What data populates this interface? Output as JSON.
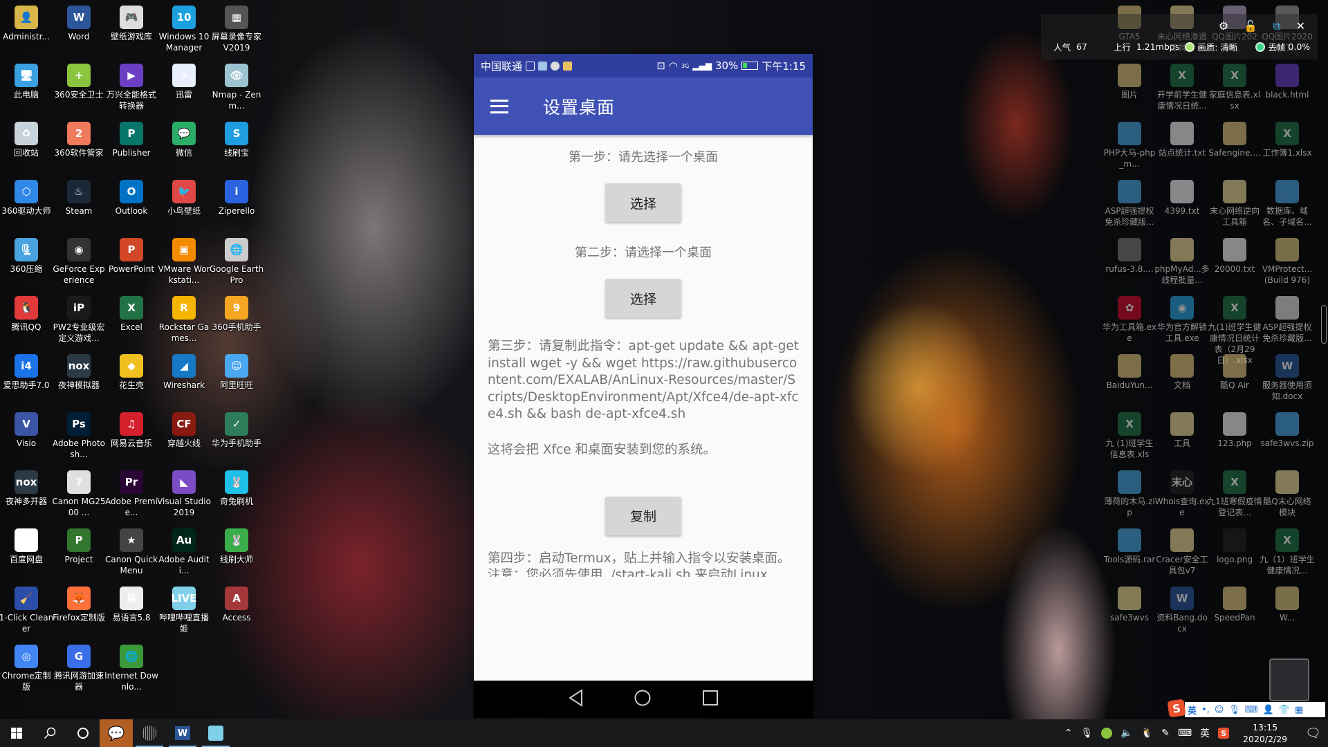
{
  "desktop_left": [
    {
      "label": "Administr...",
      "icon": "user-folder-icon",
      "color": "#d9b44a",
      "glyph": "👤"
    },
    {
      "label": "Word",
      "icon": "word-icon",
      "color": "#2b579a",
      "glyph": "W"
    },
    {
      "label": "壁纸游戏库",
      "icon": "gamepad-icon",
      "color": "#dddddd",
      "glyph": "🎮"
    },
    {
      "label": "Windows 10 Manager",
      "icon": "windows10-manager-icon",
      "color": "#1ba1e2",
      "glyph": "10"
    },
    {
      "label": "屏幕录像专家 V2019",
      "icon": "screen-recorder-icon",
      "color": "#555555",
      "glyph": "▦"
    },
    {
      "label": "此电脑",
      "icon": "computer-icon",
      "color": "#3aa0e0",
      "glyph": "🖥"
    },
    {
      "label": "360安全卫士",
      "icon": "360-safe-icon",
      "color": "#8bc53f",
      "glyph": "+"
    },
    {
      "label": "万兴全能格式转换器",
      "icon": "video-converter-icon",
      "color": "#6a3fc4",
      "glyph": "▶"
    },
    {
      "label": "迅雷",
      "icon": "thunder-icon",
      "color": "#e8eefc",
      "glyph": "✈"
    },
    {
      "label": "Nmap - Zenm...",
      "icon": "nmap-eye-icon",
      "color": "#9cc3d0",
      "glyph": "👁"
    },
    {
      "label": "回收站",
      "icon": "recycle-bin-icon",
      "color": "#c8d2da",
      "glyph": "♻"
    },
    {
      "label": "360软件管家",
      "icon": "360-software-manager-icon",
      "color": "#f07a5c",
      "glyph": "2"
    },
    {
      "label": "Publisher",
      "icon": "publisher-icon",
      "color": "#077568",
      "glyph": "P"
    },
    {
      "label": "微信",
      "icon": "wechat-icon",
      "color": "#2aae67",
      "glyph": "💬"
    },
    {
      "label": "线刷宝",
      "icon": "xianshuabao-icon",
      "color": "#1e9de0",
      "glyph": "S"
    },
    {
      "label": "360驱动大师",
      "icon": "360-driver-icon",
      "color": "#2f88e8",
      "glyph": "⬡"
    },
    {
      "label": "Steam",
      "icon": "steam-icon",
      "color": "#1b2838",
      "glyph": "♨"
    },
    {
      "label": "Outlook",
      "icon": "outlook-icon",
      "color": "#0072c6",
      "glyph": "O"
    },
    {
      "label": "小鸟壁纸",
      "icon": "bird-wallpaper-icon",
      "color": "#e04848",
      "glyph": "🐦"
    },
    {
      "label": "Ziperello",
      "icon": "ziperello-icon",
      "color": "#2a62e0",
      "glyph": "i"
    },
    {
      "label": "360压缩",
      "icon": "360-zip-icon",
      "color": "#4aa3df",
      "glyph": "🗜"
    },
    {
      "label": "GeForce Experience",
      "icon": "geforce-icon",
      "color": "#333333",
      "glyph": "◉"
    },
    {
      "label": "PowerPoint",
      "icon": "powerpoint-icon",
      "color": "#d24726",
      "glyph": "P"
    },
    {
      "label": "VMware Workstati...",
      "icon": "vmware-icon",
      "color": "#f38b00",
      "glyph": "▣"
    },
    {
      "label": "Google Earth Pro",
      "icon": "google-earth-icon",
      "color": "#cccccc",
      "glyph": "🌐"
    },
    {
      "label": "腾讯QQ",
      "icon": "qq-icon",
      "color": "#e23a3a",
      "glyph": "🐧"
    },
    {
      "label": "PW2专业级宏定义游戏...",
      "icon": "pw2-icon",
      "color": "#1a1a1a",
      "glyph": "iP"
    },
    {
      "label": "Excel",
      "icon": "excel-icon",
      "color": "#217346",
      "glyph": "X"
    },
    {
      "label": "Rockstar Games...",
      "icon": "rockstar-icon",
      "color": "#f4b400",
      "glyph": "R"
    },
    {
      "label": "360手机助手",
      "icon": "360-phone-assistant-icon",
      "color": "#f5a623",
      "glyph": "9"
    },
    {
      "label": "爱思助手7.0",
      "icon": "i4-icon",
      "color": "#1a73e8",
      "glyph": "i4"
    },
    {
      "label": "夜神模拟器",
      "icon": "nox-icon",
      "color": "#2b3a44",
      "glyph": "nox"
    },
    {
      "label": "花生壳",
      "icon": "peanut-shell-icon",
      "color": "#f0c020",
      "glyph": "◆"
    },
    {
      "label": "Wireshark",
      "icon": "wireshark-icon",
      "color": "#1679c5",
      "glyph": "◢"
    },
    {
      "label": "阿里旺旺",
      "icon": "aliwangwang-icon",
      "color": "#4aa8f0",
      "glyph": "☺"
    },
    {
      "label": "Visio",
      "icon": "visio-icon",
      "color": "#3955a3",
      "glyph": "V"
    },
    {
      "label": "Adobe Photosh...",
      "icon": "photoshop-icon",
      "color": "#001e36",
      "glyph": "Ps"
    },
    {
      "label": "网易云音乐",
      "icon": "netease-music-icon",
      "color": "#d4202a",
      "glyph": "♫"
    },
    {
      "label": "穿越火线",
      "icon": "crossfire-icon",
      "color": "#8a1a10",
      "glyph": "CF"
    },
    {
      "label": "华为手机助手",
      "icon": "huawei-hisuite-icon",
      "color": "#2e7d5a",
      "glyph": "✓"
    },
    {
      "label": "夜神多开器",
      "icon": "nox-multi-icon",
      "color": "#2b3a44",
      "glyph": "nox"
    },
    {
      "label": "Canon MG2500 ...",
      "icon": "canon-printer-icon",
      "color": "#e0e0e0",
      "glyph": "?"
    },
    {
      "label": "Adobe Premie...",
      "icon": "premiere-icon",
      "color": "#2a0634",
      "glyph": "Pr"
    },
    {
      "label": "Visual Studio 2019",
      "icon": "visual-studio-icon",
      "color": "#7b4cc4",
      "glyph": "◣"
    },
    {
      "label": "奇兔刷机",
      "icon": "qitu-icon",
      "color": "#1ec0e8",
      "glyph": "🐰"
    },
    {
      "label": "百度网盘",
      "icon": "baidu-netdisk-icon",
      "color": "#ffffff",
      "glyph": "☁"
    },
    {
      "label": "Project",
      "icon": "project-icon",
      "color": "#31752f",
      "glyph": "P"
    },
    {
      "label": "Canon Quick Menu",
      "icon": "canon-quick-menu-icon",
      "color": "#444444",
      "glyph": "★"
    },
    {
      "label": "Adobe Auditi...",
      "icon": "audition-icon",
      "color": "#00261c",
      "glyph": "Au"
    },
    {
      "label": "线刷大师",
      "icon": "xianshua-master-icon",
      "color": "#3aae4a",
      "glyph": "🐰"
    },
    {
      "label": "1-Click Cleaner",
      "icon": "broom-icon",
      "color": "#2b4fa8",
      "glyph": "🧹"
    },
    {
      "label": "Firefox定制版",
      "icon": "firefox-icon",
      "color": "#ff7139",
      "glyph": "🦊"
    },
    {
      "label": "易语言5.8",
      "icon": "eyuyan-icon",
      "color": "#eeeeee",
      "glyph": "易"
    },
    {
      "label": "哔哩哔哩直播姬",
      "icon": "bilibili-live-icon",
      "color": "#7fd0e8",
      "glyph": "LIVE"
    },
    {
      "label": "Access",
      "icon": "access-icon",
      "color": "#a4373a",
      "glyph": "A"
    },
    {
      "label": "Chrome定制版",
      "icon": "chrome-icon",
      "color": "#4285f4",
      "glyph": "◎"
    },
    {
      "label": "腾讯网游加速器",
      "icon": "tencent-accelerator-icon",
      "color": "#3a6ee8",
      "glyph": "G"
    },
    {
      "label": "Internet Downlo...",
      "icon": "idm-icon",
      "color": "#3a9a3a",
      "glyph": "🌐"
    }
  ],
  "desktop_right": [
    {
      "label": "GTA5",
      "icon": "folder-icon",
      "color": "#d9c27a",
      "glyph": ""
    },
    {
      "label": "末心网络渗透工具箱",
      "icon": "folder-icon",
      "color": "#e8d694",
      "glyph": ""
    },
    {
      "label": "QQ图片2020...",
      "icon": "image-file-icon",
      "color": "#b9a8c8",
      "glyph": ""
    },
    {
      "label": "QQ图片2020011...",
      "icon": "image-file-icon",
      "color": "#9a9a9a",
      "glyph": ""
    },
    {
      "label": "图片",
      "icon": "folder-icon",
      "color": "#d9c27a",
      "glyph": ""
    },
    {
      "label": "开学前学生健康情况日统...",
      "icon": "excel-file-icon",
      "color": "#217346",
      "glyph": "X"
    },
    {
      "label": "家庭信息表.xlsx",
      "icon": "excel-file-icon",
      "color": "#217346",
      "glyph": "X"
    },
    {
      "label": "black.html",
      "icon": "firefox-html-icon",
      "color": "#6a3fc4",
      "glyph": ""
    },
    {
      "label": "PHP大马-php_m...",
      "icon": "zip-file-icon",
      "color": "#4aa3df",
      "glyph": ""
    },
    {
      "label": "站点统计.txt",
      "icon": "text-file-icon",
      "color": "#eeeeee",
      "glyph": ""
    },
    {
      "label": "Safengine....",
      "icon": "folder-icon",
      "color": "#d9c27a",
      "glyph": ""
    },
    {
      "label": "工作簿1.xlsx",
      "icon": "excel-file-icon",
      "color": "#217346",
      "glyph": "X"
    },
    {
      "label": "ASP超强提权免杀珍藏版...",
      "icon": "zip-file-icon",
      "color": "#4aa3df",
      "glyph": ""
    },
    {
      "label": "4399.txt",
      "icon": "text-file-icon",
      "color": "#eeeeee",
      "glyph": ""
    },
    {
      "label": "末心网络逆向工具箱",
      "icon": "folder-icon",
      "color": "#e8d694",
      "glyph": ""
    },
    {
      "label": "数据库、域名、子域名...",
      "icon": "zip-file-icon",
      "color": "#4aa3df",
      "glyph": ""
    },
    {
      "label": "rufus-3.8....",
      "icon": "usb-icon",
      "color": "#777777",
      "glyph": ""
    },
    {
      "label": "phpMyAd...多线程批量...",
      "icon": "folder-icon",
      "color": "#e8d694",
      "glyph": ""
    },
    {
      "label": "20000.txt",
      "icon": "text-file-icon",
      "color": "#eeeeee",
      "glyph": ""
    },
    {
      "label": "VMProtect... (Build 976)",
      "icon": "folder-icon",
      "color": "#d9c27a",
      "glyph": ""
    },
    {
      "label": "华为工具箱.exe",
      "icon": "huawei-icon",
      "color": "#cf0a2c",
      "glyph": "✿"
    },
    {
      "label": "华为官方解锁工具.exe",
      "icon": "unlock-tool-icon",
      "color": "#2aa0e0",
      "glyph": "◉"
    },
    {
      "label": "九(1)班学生健康情况日统计表（2月29日）.xlsx",
      "icon": "excel-file-icon",
      "color": "#217346",
      "glyph": "X"
    },
    {
      "label": "ASP超强提权免杀珍藏版...",
      "icon": "blank-file-icon",
      "color": "#dddddd",
      "glyph": ""
    },
    {
      "label": "BaiduYun...",
      "icon": "folder-icon",
      "color": "#d9c27a",
      "glyph": ""
    },
    {
      "label": "文档",
      "icon": "folder-icon",
      "color": "#d9c27a",
      "glyph": ""
    },
    {
      "label": "酷Q Air",
      "icon": "folder-icon",
      "color": "#d9c27a",
      "glyph": ""
    },
    {
      "label": "服务器使用须知.docx",
      "icon": "word-file-icon",
      "color": "#2b579a",
      "glyph": "W"
    },
    {
      "label": "九 (1)班学生信息表.xls",
      "icon": "excel-file-icon",
      "color": "#217346",
      "glyph": "X"
    },
    {
      "label": "工具",
      "icon": "folder-icon",
      "color": "#e8d694",
      "glyph": ""
    },
    {
      "label": "123.php",
      "icon": "blank-file-icon",
      "color": "#eeeeee",
      "glyph": ""
    },
    {
      "label": "safe3wvs.zip",
      "icon": "zip-file-icon",
      "color": "#4aa3df",
      "glyph": ""
    },
    {
      "label": "薄荷的木马.zip",
      "icon": "zip-file-icon",
      "color": "#4aa3df",
      "glyph": ""
    },
    {
      "label": "Whois查询.exe",
      "icon": "whois-icon",
      "color": "#222222",
      "glyph": "末心"
    },
    {
      "label": "九1班寒假疫情登记表...",
      "icon": "excel-file-icon",
      "color": "#217346",
      "glyph": "X"
    },
    {
      "label": "酷Q末心网络模块",
      "icon": "folder-icon",
      "color": "#e8d694",
      "glyph": ""
    },
    {
      "label": "Tools源码.rar",
      "icon": "zip-file-icon",
      "color": "#4aa3df",
      "glyph": ""
    },
    {
      "label": "Cracer安全工具包v7",
      "icon": "folder-icon",
      "color": "#e8d694",
      "glyph": ""
    },
    {
      "label": "logo.png",
      "icon": "image-file-icon",
      "color": "#222222",
      "glyph": ""
    },
    {
      "label": "九（1）班学生健康情况...",
      "icon": "excel-file-icon",
      "color": "#217346",
      "glyph": "X"
    },
    {
      "label": "safe3wvs",
      "icon": "folder-icon",
      "color": "#e8d694",
      "glyph": ""
    },
    {
      "label": "资料Bang.docx",
      "icon": "word-file-icon",
      "color": "#2b579a",
      "glyph": "W"
    },
    {
      "label": "SpeedPan",
      "icon": "folder-icon",
      "color": "#d9c27a",
      "glyph": ""
    },
    {
      "label": "W...",
      "icon": "folder-icon",
      "color": "#d9c27a",
      "glyph": ""
    }
  ],
  "stream_overlay": {
    "popularity_label": "人气",
    "popularity_value": "67",
    "upload_label": "上行",
    "upload_value": "1.21mbps",
    "quality_label": "画质: 清晰",
    "drop_label": "丢帧",
    "drop_value": "0.0%",
    "quality_dot_color": "#a6e36e",
    "drop_dot_color": "#3fd38a"
  },
  "phone": {
    "status_bar": {
      "carrier": "中国联通",
      "battery": "30%",
      "time": "下午1:15",
      "network": "3G",
      "color": "#303f9f"
    },
    "app_bar": {
      "title": "设置桌面",
      "color": "#3f51b5"
    },
    "step1": {
      "text": "第一步：请先选择一个桌面",
      "button": "选择"
    },
    "step2": {
      "text": "第二步：请选择一个桌面",
      "button": "选择"
    },
    "step3": {
      "text": "第三步：请复制此指令：apt-get update && apt-get install wget -y && wget https://raw.githubusercontent.com/EXALAB/AnLinux-Resources/master/Scripts/DesktopEnvironment/Apt/Xfce4/de-apt-xfce4.sh && bash de-apt-xfce4.sh",
      "note": "这将会把 Xfce 和桌面安装到您的系统。",
      "button": "复制"
    },
    "step4": {
      "text": "第四步：启动Termux，贴上并输入指令以安装桌面。注意：您必须先使用 ./start-kali.sh 来启动Linux"
    },
    "nav": {
      "back": "back-icon",
      "home": "home-icon",
      "recents": "recents-icon"
    }
  },
  "taskbar": {
    "start": "windows-start-icon",
    "search": "search-icon",
    "cortana": "cortana-icon",
    "apps": [
      {
        "name": "wechat",
        "active": true
      },
      {
        "name": "screen-recorder",
        "active": false
      },
      {
        "name": "word",
        "active": false
      },
      {
        "name": "bilibili-live",
        "active": false
      }
    ],
    "tray": {
      "ime_lang": "英",
      "time": "13:15",
      "date": "2020/2/29"
    }
  },
  "ime_toolbar": {
    "lang": "英",
    "punct": "•,"
  }
}
